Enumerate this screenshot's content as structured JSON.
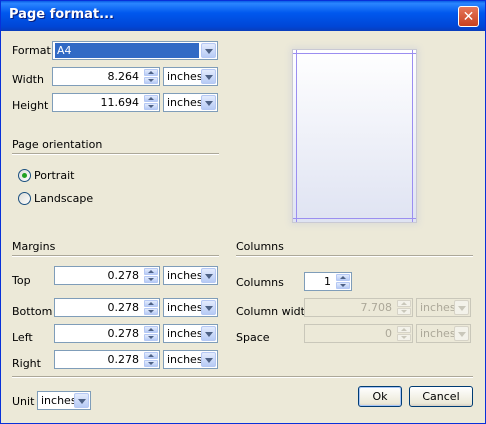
{
  "window": {
    "title": "Page format...",
    "close": "✕"
  },
  "format": {
    "label": "Format",
    "value": "A4"
  },
  "width": {
    "label": "Width",
    "value": "8.264",
    "unit": "inches"
  },
  "height": {
    "label": "Height",
    "value": "11.694",
    "unit": "inches"
  },
  "orientation": {
    "section": "Page orientation",
    "portrait": "Portrait",
    "landscape": "Landscape",
    "selected": "Portrait"
  },
  "margins": {
    "section": "Margins",
    "top": {
      "label": "Top",
      "value": "0.278",
      "unit": "inches"
    },
    "bottom": {
      "label": "Bottom",
      "value": "0.278",
      "unit": "inches"
    },
    "left": {
      "label": "Left",
      "value": "0.278",
      "unit": "inches"
    },
    "right": {
      "label": "Right",
      "value": "0.278",
      "unit": "inches"
    }
  },
  "columns": {
    "section": "Columns",
    "count": {
      "label": "Columns",
      "value": "1"
    },
    "width": {
      "label": "Column width",
      "value": "7.708",
      "unit": "inches"
    },
    "space": {
      "label": "Space",
      "value": "0",
      "unit": "inches"
    }
  },
  "unit": {
    "label": "Unit",
    "value": "inches"
  },
  "buttons": {
    "ok": "Ok",
    "cancel": "Cancel"
  },
  "colors": {
    "titlebar": "#0058ee",
    "preview_margin": "#9b8ef0",
    "selection": "#316ac5"
  }
}
